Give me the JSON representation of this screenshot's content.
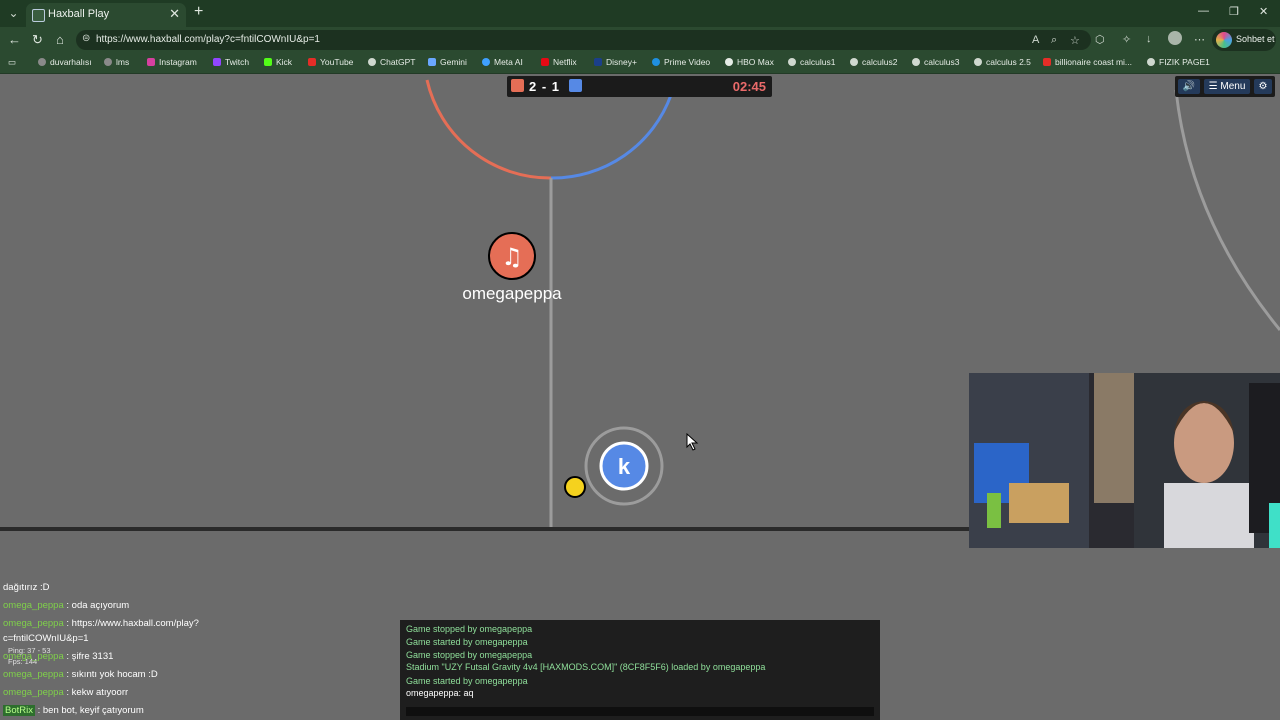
{
  "browser": {
    "tab_title": "Haxball Play",
    "url": "https://www.haxball.com/play?c=fntilCOWnIU&p=1",
    "copilot_label": "Sohbet et",
    "bookmarks": [
      "duvarhalısı",
      "lms",
      "Instagram",
      "Twitch",
      "Kick",
      "YouTube",
      "ChatGPT",
      "Gemini",
      "Meta AI",
      "Netflix",
      "Disney+",
      "Prime Video",
      "HBO Max",
      "calculus1",
      "calculus2",
      "calculus3",
      "calculus 2.5",
      "billionaire coast mi...",
      "FIZIK PAGE1"
    ]
  },
  "game": {
    "score": "2 - 1",
    "timer": "02:45",
    "menu_label": "Menu",
    "red_player": {
      "name": "omegapeppa",
      "avatar": "♫"
    },
    "blue_player": {
      "avatar": "k"
    },
    "colors": {
      "red": "#e56e56",
      "blue": "#5689e5",
      "ball": "#f5d21e",
      "field": "#6b6b6b"
    }
  },
  "chat": [
    {
      "name": "",
      "text": "dağıtırız :D"
    },
    {
      "name": "omega_peppa",
      "text": " : oda açıyorum"
    },
    {
      "name": "omega_peppa",
      "text": " : https://www.haxball.com/play?"
    },
    {
      "name": "",
      "text": "c=fntilCOWnIU&p=1"
    },
    {
      "name": "omega_peppa",
      "text": " : şifre 3131"
    },
    {
      "name": "omega_peppa",
      "text": " : sıkıntı yok hocam :D"
    },
    {
      "name": "omega_peppa",
      "text": " : kekw atıyoorr"
    },
    {
      "name": "BotRix",
      "text": " : ben bot, keyif çatıyorum"
    }
  ],
  "stats": {
    "ping": "Ping: 37 - 53",
    "fps": "Fps: 144"
  },
  "log": [
    "Game stopped by omegapeppa",
    "Game started by omegapeppa",
    "Game stopped by omegapeppa",
    "Stadium \"UZY Futsal Gravity 4v4 [HAXMODS.COM]\" (8CF8F5F6) loaded by omegapeppa",
    "Game started by omegapeppa",
    "omegapeppa: aq"
  ]
}
